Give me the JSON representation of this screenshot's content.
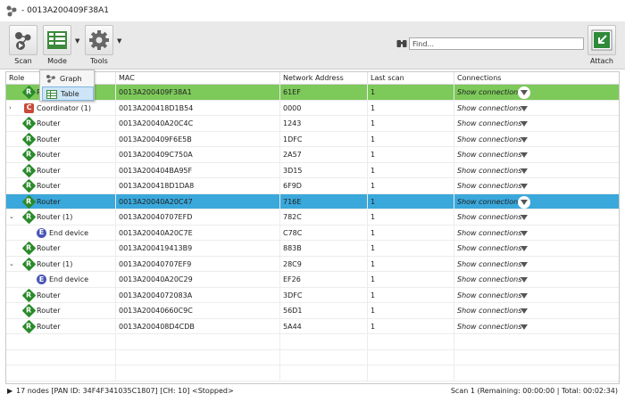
{
  "window": {
    "title": "- 0013A200409F38A1"
  },
  "toolbar": {
    "scan_label": "Scan",
    "mode_label": "Mode",
    "tools_label": "Tools",
    "attach_label": "Attach",
    "find_placeholder": "Find..."
  },
  "mode_menu": {
    "items": [
      {
        "label": "Graph"
      },
      {
        "label": "Table"
      }
    ]
  },
  "columns": {
    "role": "Role",
    "mac": "MAC",
    "network": "Network Address",
    "last_scan": "Last scan",
    "connections": "Connections"
  },
  "rows": [
    {
      "role": "Router",
      "icon": "R",
      "mac": "0013A200409F38A1",
      "net": "61EF",
      "scan": "1",
      "conn": "Show connections"
    },
    {
      "role": "Coordinator (1)",
      "icon": "C",
      "mac": "0013A200418D1B54",
      "net": "0000",
      "scan": "1",
      "conn": "Show connections"
    },
    {
      "role": "Router",
      "icon": "R",
      "mac": "0013A20040A20C4C",
      "net": "1243",
      "scan": "1",
      "conn": "Show connections"
    },
    {
      "role": "Router",
      "icon": "R",
      "mac": "0013A200409F6E5B",
      "net": "1DFC",
      "scan": "1",
      "conn": "Show connections"
    },
    {
      "role": "Router",
      "icon": "R",
      "mac": "0013A200409C750A",
      "net": "2A57",
      "scan": "1",
      "conn": "Show connections"
    },
    {
      "role": "Router",
      "icon": "R",
      "mac": "0013A200404BA95F",
      "net": "3D15",
      "scan": "1",
      "conn": "Show connections"
    },
    {
      "role": "Router",
      "icon": "R",
      "mac": "0013A200418D1DA8",
      "net": "6F9D",
      "scan": "1",
      "conn": "Show connections"
    },
    {
      "role": "Router",
      "icon": "R",
      "mac": "0013A20040A20C47",
      "net": "716E",
      "scan": "1",
      "conn": "Show connections"
    },
    {
      "role": "Router (1)",
      "icon": "R",
      "mac": "0013A20040707EFD",
      "net": "782C",
      "scan": "1",
      "conn": "Show connections"
    },
    {
      "role": "End device",
      "icon": "E",
      "mac": "0013A20040A20C7E",
      "net": "C78C",
      "scan": "1",
      "conn": "Show connections"
    },
    {
      "role": "Router",
      "icon": "R",
      "mac": "0013A200419413B9",
      "net": "883B",
      "scan": "1",
      "conn": "Show connections"
    },
    {
      "role": "Router (1)",
      "icon": "R",
      "mac": "0013A20040707EF9",
      "net": "28C9",
      "scan": "1",
      "conn": "Show connections"
    },
    {
      "role": "End device",
      "icon": "E",
      "mac": "0013A20040A20C29",
      "net": "EF26",
      "scan": "1",
      "conn": "Show connections"
    },
    {
      "role": "Router",
      "icon": "R",
      "mac": "0013A2004072083A",
      "net": "3DFC",
      "scan": "1",
      "conn": "Show connections"
    },
    {
      "role": "Router",
      "icon": "R",
      "mac": "0013A20040660C9C",
      "net": "56D1",
      "scan": "1",
      "conn": "Show connections"
    },
    {
      "role": "Router",
      "icon": "R",
      "mac": "0013A200408D4CDB",
      "net": "5A44",
      "scan": "1",
      "conn": "Show connections"
    }
  ],
  "status": {
    "left": "17 nodes [PAN ID: 34F4F341035C1807] [CH: 10] <Stopped>",
    "right": "Scan 1 (Remaining: 00:00:00 | Total: 00:02:34)"
  },
  "colors": {
    "selected_green": "#7dc95a",
    "selected_blue": "#3ba8db",
    "router": "#2a8a2a",
    "coordinator": "#c94a3a",
    "end_device": "#4a55b8"
  }
}
